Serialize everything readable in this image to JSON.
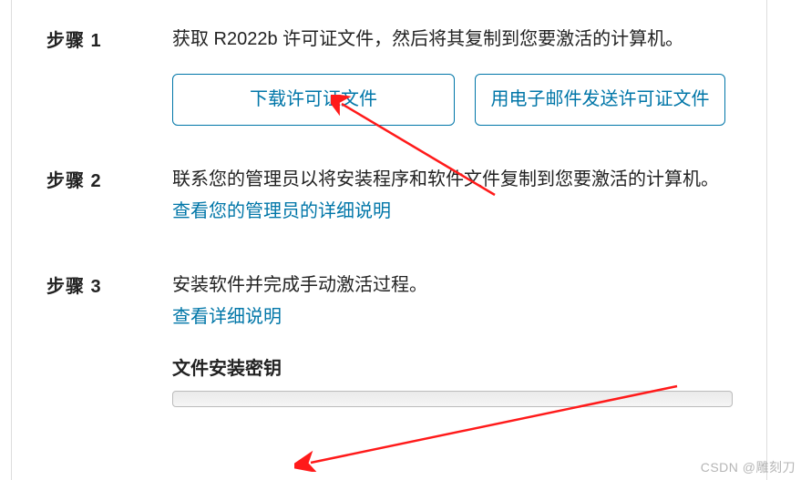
{
  "steps": [
    {
      "label": "步骤 1",
      "desc": "获取 R2022b 许可证文件，然后将其复制到您要激活的计算机。",
      "buttons": [
        {
          "label": "下载许可证文件"
        },
        {
          "label": "用电子邮件发送许可证文件"
        }
      ]
    },
    {
      "label": "步骤 2",
      "desc": "联系您的管理员以将安装程序和软件文件复制到您要激活的计算机。",
      "link": "查看您的管理员的详细说明"
    },
    {
      "label": "步骤 3",
      "desc": "安装软件并完成手动激活过程。",
      "link": "查看详细说明",
      "section_header": "文件安装密钥"
    }
  ],
  "watermark": "CSDN @雕刻刀"
}
